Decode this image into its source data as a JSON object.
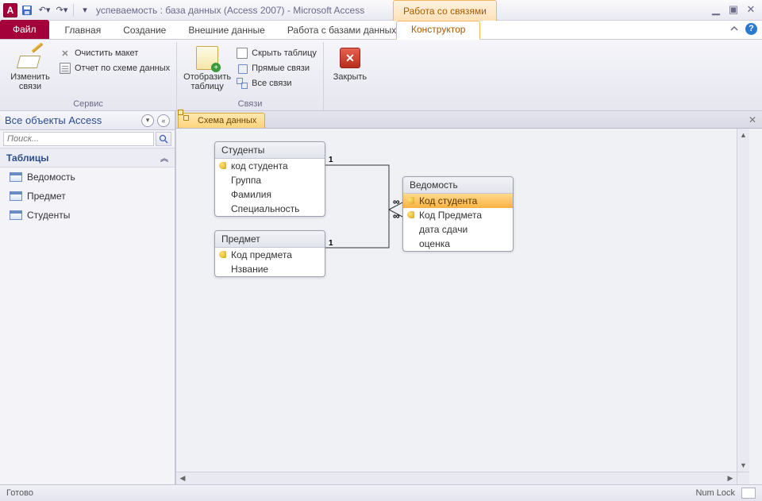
{
  "titlebar": {
    "app_letter": "A",
    "title": "успеваемость : база данных (Access 2007)  -  Microsoft Access",
    "context_caption": "Работа со связями"
  },
  "tabs": {
    "file": "Файл",
    "home": "Главная",
    "create": "Создание",
    "external": "Внешние данные",
    "dbtool": "Работа с базами данных",
    "designer": "Конструктор"
  },
  "ribbon": {
    "group_tools": "Сервис",
    "group_rel": "Связи",
    "edit_rel": "Изменить связи",
    "clear_layout": "Очистить макет",
    "rel_report": "Отчет по схеме данных",
    "show_table": "Отобразить таблицу",
    "hide_table": "Скрыть таблицу",
    "direct_rel": "Прямые связи",
    "all_rel": "Все связи",
    "close": "Закрыть"
  },
  "nav": {
    "title": "Все объекты Access",
    "search_placeholder": "Поиск...",
    "tables_cat": "Таблицы",
    "items": [
      {
        "label": "Ведомость"
      },
      {
        "label": "Предмет"
      },
      {
        "label": "Студенты"
      }
    ]
  },
  "doc": {
    "tab": "Схема данных"
  },
  "diagram": {
    "tables": {
      "students": {
        "title": "Студенты",
        "fields": [
          "код студента",
          "Группа",
          "Фамилия",
          "Специальность"
        ],
        "keys": [
          0
        ]
      },
      "subject": {
        "title": "Предмет",
        "fields": [
          "Код предмета",
          "Нзвание"
        ],
        "keys": [
          0
        ]
      },
      "sheet": {
        "title": "Ведомость",
        "fields": [
          "Код студента",
          "Код Предмета",
          "дата сдачи",
          "оценка"
        ],
        "keys": [
          0,
          1
        ],
        "selected": 0
      }
    },
    "rel_labels": {
      "one": "1",
      "many": "∞"
    }
  },
  "status": {
    "ready": "Готово",
    "numlock": "Num Lock"
  }
}
